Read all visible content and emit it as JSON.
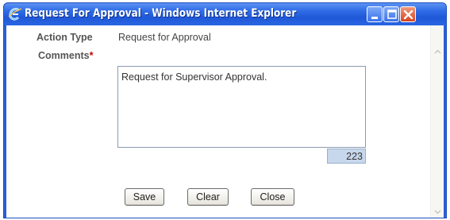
{
  "window": {
    "title": "Request For Approval - Windows Internet Explorer",
    "icon": "internet-explorer-icon",
    "controls": [
      "minimize-icon",
      "maximize-icon",
      "close-icon"
    ]
  },
  "form": {
    "action_type_label": "Action Type",
    "action_type_value": "Request for Approval",
    "comments_label": "Comments",
    "required_mark": "*",
    "comments_value": "Request for Supervisor Approval.",
    "char_counter": "223"
  },
  "buttons": {
    "save": "Save",
    "clear": "Clear",
    "close": "Close"
  },
  "colors": {
    "titlebar": "#2f6ce6",
    "close_button": "#d8431e",
    "required": "#cc0000",
    "counter_bg": "#c8d8ec"
  }
}
